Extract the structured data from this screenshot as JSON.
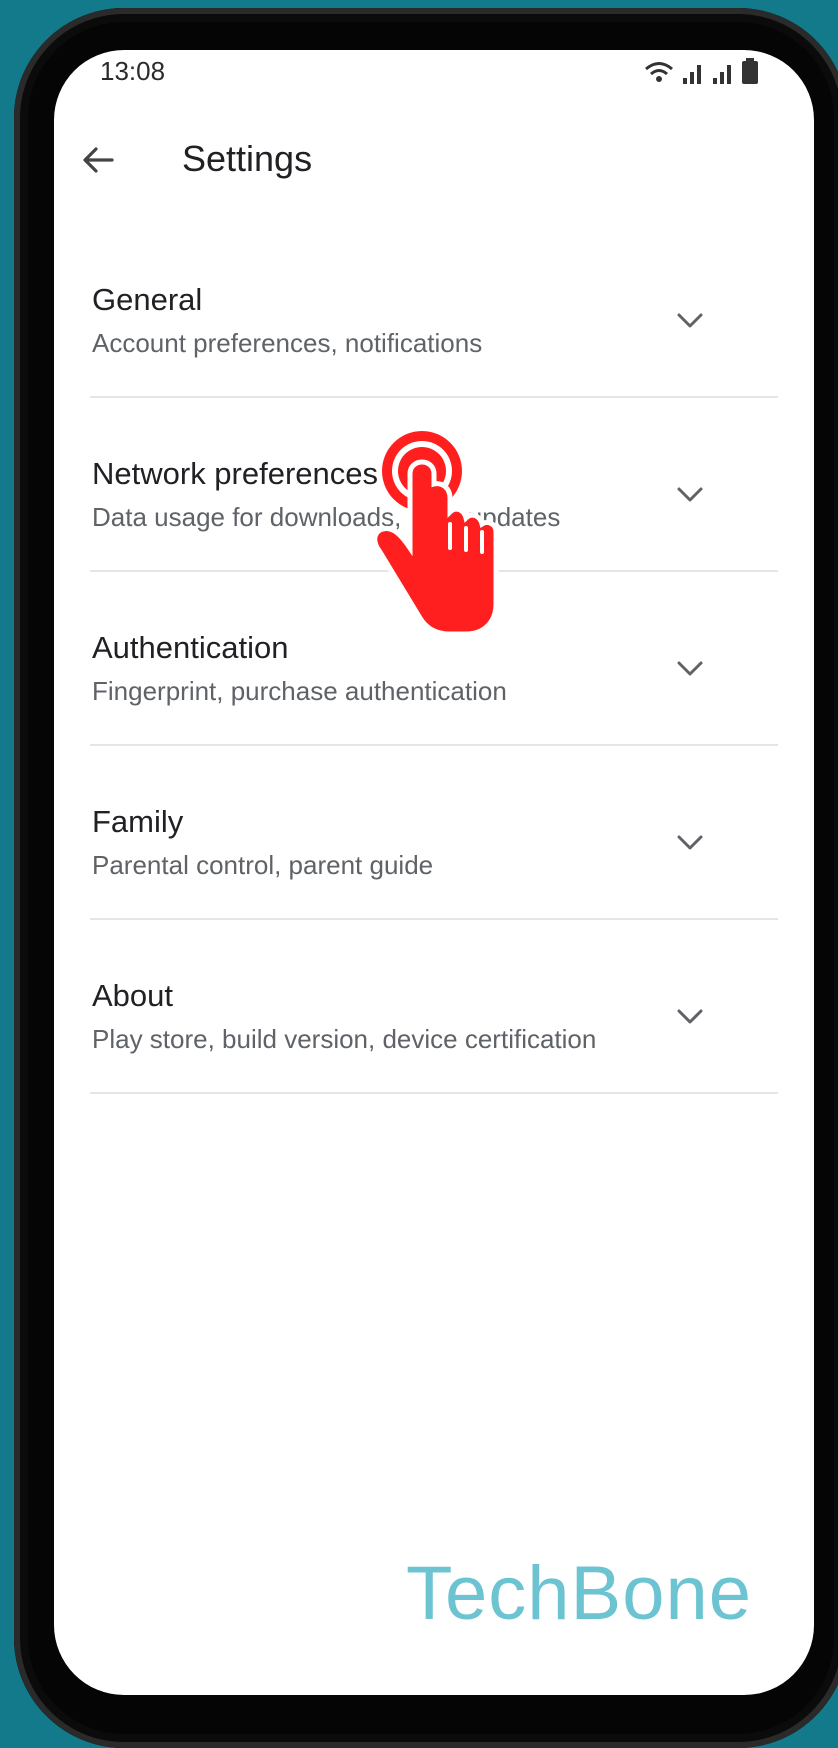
{
  "status_bar": {
    "time": "13:08"
  },
  "app_bar": {
    "title": "Settings",
    "back_icon": "arrow-back-icon"
  },
  "settings": [
    {
      "title": "General",
      "subtitle": "Account preferences, notifications"
    },
    {
      "title": "Network preferences",
      "subtitle": "Data usage for downloads, auto-updates"
    },
    {
      "title": "Authentication",
      "subtitle": "Fingerprint, purchase authentication"
    },
    {
      "title": "Family",
      "subtitle": "Parental control, parent guide"
    },
    {
      "title": "About",
      "subtitle": "Play store, build version, device certification"
    }
  ],
  "watermark": "TechBone",
  "colors": {
    "background": "#137a8c",
    "tap_indicator": "#ff1f1f",
    "watermark": "#6cc3d1"
  }
}
